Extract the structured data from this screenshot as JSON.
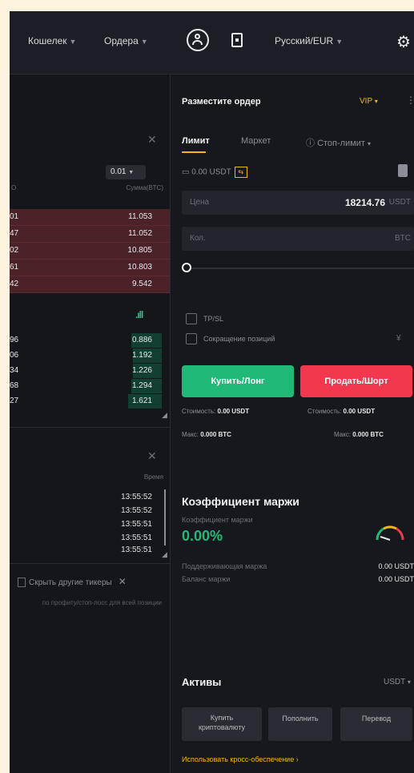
{
  "topbar": {
    "wallet": "Кошелек",
    "orders": "Ордера",
    "language": "Русский/EUR"
  },
  "orderbook": {
    "step": "0.01",
    "col_total": "Сумма(BTC)",
    "sell_rows": [
      {
        "a": "01",
        "b": "11.053"
      },
      {
        "a": "47",
        "b": "11.052"
      },
      {
        "a": "02",
        "b": "10.805"
      },
      {
        "a": "61",
        "b": "10.803"
      },
      {
        "a": "42",
        "b": "9.542"
      }
    ],
    "buy_rows": [
      {
        "a": "96",
        "b": "0.886"
      },
      {
        "a": "06",
        "b": "1.192"
      },
      {
        "a": "34",
        "b": "1.226"
      },
      {
        "a": "68",
        "b": "1.294"
      },
      {
        "a": "27",
        "b": "1.621"
      }
    ]
  },
  "trades": {
    "col_time": "Время",
    "times": [
      "13:55:52",
      "13:55:52",
      "13:55:51",
      "13:55:51",
      "13:55:51"
    ]
  },
  "positions": {
    "hide_other": "Скрыть другие тикеры",
    "hint": "по профиту/стоп-лосс для всей позиции"
  },
  "order": {
    "title": "Разместите ордер",
    "vip": "VIP",
    "tabs": [
      "Лимит",
      "Маркет",
      "Стоп-лимит"
    ],
    "available": "0.00 USDT",
    "price_label": "Цена",
    "price_value": "18214.76",
    "price_unit": "USDT",
    "qty_label": "Кол.",
    "qty_unit": "BTC",
    "tpsl": "TP/SL",
    "reduce": "Сокращение позиций",
    "buy": "Купить/Лонг",
    "sell": "Продать/Шорт",
    "cost_buy_label": "Стоимость:",
    "cost_buy_value": "0.00 USDT",
    "cost_sell_label": "Стоимость:",
    "cost_sell_value": "0.00 USDT",
    "max_buy_label": "Макс:",
    "max_buy_value": "0.000 BTC",
    "max_sell_label": "Макс:",
    "max_sell_value": "0.000 BTC"
  },
  "margin": {
    "title": "Коэффициент маржи",
    "sub": "Коэффициент маржи",
    "ratio": "0.00%",
    "maint_label": "Поддерживающая маржа",
    "maint_value": "0.00 USDT",
    "balance_label": "Баланс маржи",
    "balance_value": "0.00 USDT"
  },
  "assets": {
    "title": "Активы",
    "currency": "USDT",
    "buy_crypto_1": "Купить",
    "buy_crypto_2": "криптовалюту",
    "deposit": "Пополнить",
    "transfer": "Перевод",
    "cross": "Использовать кросс-обеспечение"
  },
  "colors": {
    "buy": "#21b978",
    "sell": "#f1384e",
    "accent": "#f0b90b",
    "bg": "#17181e"
  }
}
